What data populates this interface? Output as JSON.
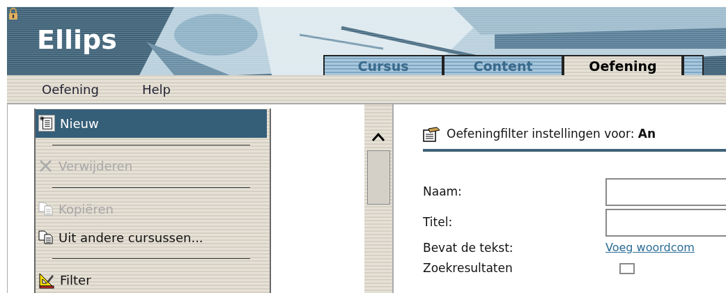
{
  "header": {
    "logo": "Ellips"
  },
  "tabs": [
    {
      "label": "Cursus",
      "selected": false
    },
    {
      "label": "Content",
      "selected": false
    },
    {
      "label": "Oefening",
      "selected": true
    },
    {
      "selected": false
    }
  ],
  "menubar": [
    "Oefening",
    "Help"
  ],
  "dropdown": [
    {
      "kind": "item",
      "label": "Nieuw",
      "selected": true,
      "disabled": false
    },
    {
      "kind": "separator"
    },
    {
      "kind": "item",
      "label": "Verwijderen",
      "selected": false,
      "disabled": true
    },
    {
      "kind": "separator"
    },
    {
      "kind": "item",
      "label": "Kopiëren",
      "selected": false,
      "disabled": true
    },
    {
      "kind": "item",
      "label": "Uit andere cursussen...",
      "selected": false,
      "disabled": false
    },
    {
      "kind": "separator"
    },
    {
      "kind": "item",
      "label": "Filter",
      "selected": false,
      "disabled": false
    }
  ],
  "panel": {
    "title": "Oefeningfilter instellingen voor: **An**",
    "fields": [
      {
        "kind": "input",
        "label": "Naam:"
      },
      {
        "kind": "input",
        "label": "Titel:"
      },
      {
        "kind": "link",
        "label": "Bevat de tekst:",
        "link": "Voeg woordcom"
      },
      {
        "kind": "checkbox",
        "label": "Zoekresultaten",
        "checked": false
      }
    ]
  }
}
